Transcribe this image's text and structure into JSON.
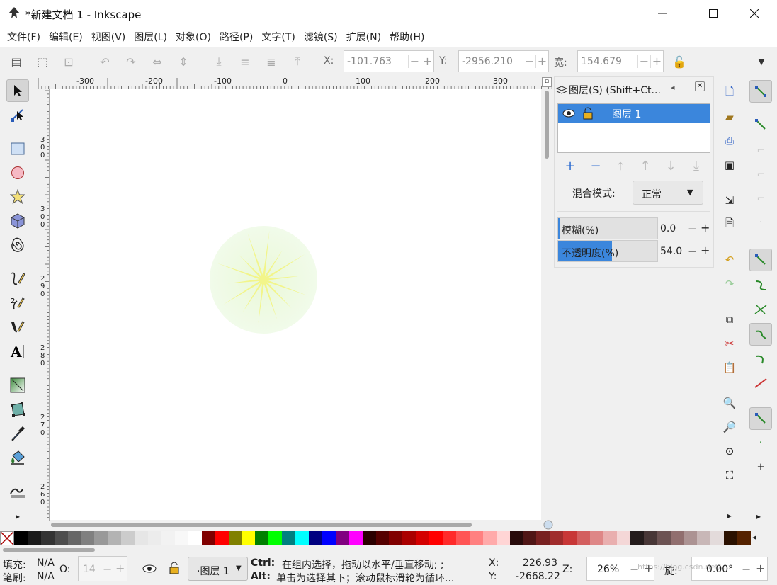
{
  "window": {
    "title": "*新建文档 1 - Inkscape",
    "minimize": "─",
    "maximize": "☐",
    "close": "✕"
  },
  "menu": [
    "文件(F)",
    "编辑(E)",
    "视图(V)",
    "图层(L)",
    "对象(O)",
    "路径(P)",
    "文字(T)",
    "滤镜(S)",
    "扩展(N)",
    "帮助(H)"
  ],
  "toolbar": {
    "x_label": "X:",
    "x_value": "-101.763",
    "y_label": "Y:",
    "y_value": "-2956.210",
    "w_label": "宽:",
    "w_value": "154.679",
    "minus": "−",
    "plus": "+"
  },
  "ruler": {
    "top_ticks": [
      "-300",
      "-200",
      "-100",
      "0",
      "100",
      "200",
      "300"
    ],
    "left_ticks": [
      "3\n0\n0",
      "3\n0\n0",
      "2\n9\n0",
      "2\n8\n0",
      "2\n7\n0",
      "2\n6\n0"
    ]
  },
  "layers_panel": {
    "title": "图层(S) (Shift+Ct...",
    "layer_name": "图层 1",
    "blend_label": "混合模式:",
    "blend_value": "正常",
    "blur_label": "模糊(%)",
    "blur_value": "0.0",
    "opacity_label": "不透明度(%)",
    "opacity_value": "54.0",
    "opacity_fraction": 0.54
  },
  "palette_colors": [
    "#000000",
    "#1a1a1a",
    "#333333",
    "#4d4d4d",
    "#666666",
    "#808080",
    "#999999",
    "#b3b3b3",
    "#cccccc",
    "#e6e6e6",
    "#ececec",
    "#f2f2f2",
    "#f8f8f8",
    "#ffffff",
    "#800000",
    "#ff0000",
    "#808000",
    "#ffff00",
    "#008000",
    "#00ff00",
    "#008080",
    "#00ffff",
    "#000080",
    "#0000ff",
    "#800080",
    "#ff00ff",
    "#2b0000",
    "#550000",
    "#800000",
    "#aa0000",
    "#d40000",
    "#ff0000",
    "#ff2a2a",
    "#ff5555",
    "#ff8080",
    "#ffaaaa",
    "#ffd5d5",
    "#280b0b",
    "#501616",
    "#782121",
    "#a02c2c",
    "#c83737",
    "#d35f5f",
    "#de8787",
    "#e9afaf",
    "#f4d7d7",
    "#241c1c",
    "#483737",
    "#6c5353",
    "#916f6f",
    "#ac9393",
    "#c8b7b7",
    "#e3dbdb",
    "#2b1100",
    "#552200"
  ],
  "status": {
    "fill_label": "填充:",
    "fill_value": "N/A",
    "stroke_label": "笔刷:",
    "stroke_value": "N/A",
    "opacity_label": "O:",
    "opacity_value": "14",
    "layer_value": "·图层 1",
    "hint_line1_key": "Ctrl:",
    "hint_line1": "在组内选择，拖动以水平/垂直移动; ;",
    "hint_line2_key": "Alt:",
    "hint_line2": "单击为选择其下；滚动鼠标滑轮为循环...",
    "x_label": "X:",
    "x_value": "226.93",
    "y_label": "Y:",
    "y_value": "-2668.22",
    "zoom_label": "Z:",
    "zoom_value": "26%",
    "rot_label": "旋:",
    "rot_value": "0.00°",
    "watermark": "https://blog.csdn.net/...z"
  }
}
